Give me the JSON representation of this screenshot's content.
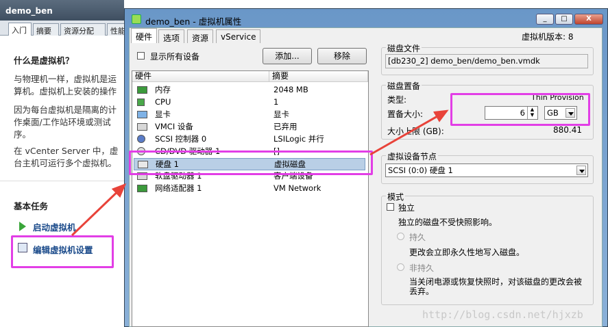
{
  "background": {
    "title": "demo_ben",
    "tabs": [
      "入门",
      "摘要",
      "资源分配",
      "性能"
    ],
    "heading": "什么是虚拟机？",
    "para1": [
      "与物理机一样，虚拟机是运",
      "算机。虚拟机上安装的操作"
    ],
    "para2": [
      "因为每台虚拟机是隔离的计",
      "作桌面/工作站环境或测试",
      "序。"
    ],
    "para3": [
      "在 vCenter Server 中，虚",
      "台主机可运行多个虚拟机。"
    ],
    "tasks_heading": "基本任务",
    "task_start": "启动虚拟机",
    "task_edit": "编辑虚拟机设置"
  },
  "dialog": {
    "title": "demo_ben - 虚拟机属性",
    "window_buttons": [
      "_",
      "□",
      "X"
    ],
    "tabs": [
      "硬件",
      "选项",
      "资源",
      "vService"
    ],
    "version": "虚拟机版本: 8",
    "show_all": "显示所有设备",
    "add_button": "添加...",
    "remove_button": "移除",
    "columns": [
      "硬件",
      "摘要"
    ],
    "devices": [
      {
        "name": "内存",
        "summary": "2048 MB",
        "icon": "memory-icon"
      },
      {
        "name": "CPU",
        "summary": "1",
        "icon": "cpu-icon"
      },
      {
        "name": "显卡",
        "summary": "显卡",
        "icon": "display-icon"
      },
      {
        "name": "VMCI 设备",
        "summary": "已弃用",
        "icon": "vmci-icon"
      },
      {
        "name": "SCSI 控制器 0",
        "summary": "LSILogic 并行",
        "icon": "scsi-icon"
      },
      {
        "name": "CD/DVD 驱动器 1",
        "summary": "[]",
        "icon": "cd-icon"
      },
      {
        "name": "硬盘 1",
        "summary": "虚拟磁盘",
        "icon": "disk-icon"
      },
      {
        "name": "软盘驱动器 1",
        "summary": "客户端设备",
        "icon": "floppy-icon"
      },
      {
        "name": "网络适配器 1",
        "summary": "VM Network",
        "icon": "network-icon"
      }
    ],
    "disk_file": {
      "label": "磁盘文件",
      "value": "[db230_2] demo_ben/demo_ben.vmdk"
    },
    "provisioning": {
      "label": "磁盘置备",
      "type_label": "类型:",
      "type_value": "Thin Provision",
      "size_label": "置备大小:",
      "size_value": "6",
      "unit": "GB",
      "max_label": "大小上限 (GB):",
      "max_value": "880.41"
    },
    "node": {
      "label": "虚拟设备节点",
      "value": "SCSI (0:0) 硬盘 1"
    },
    "mode": {
      "label": "模式",
      "independent": "独立",
      "independent_desc": "独立的磁盘不受快照影响。",
      "persistent": "持久",
      "persistent_desc": "更改会立即永久性地写入磁盘。",
      "nonpersistent": "非持久",
      "nonpersistent_desc": [
        "当关闭电源或恢复快照时，对该磁盘的更改会被",
        "丢弃。"
      ]
    }
  },
  "watermark": "http://blog.csdn.net/hjxzb",
  "colors": {
    "highlight": "#e23ee6",
    "arrow": "#e8433a",
    "selection": "#b9cfe6"
  }
}
